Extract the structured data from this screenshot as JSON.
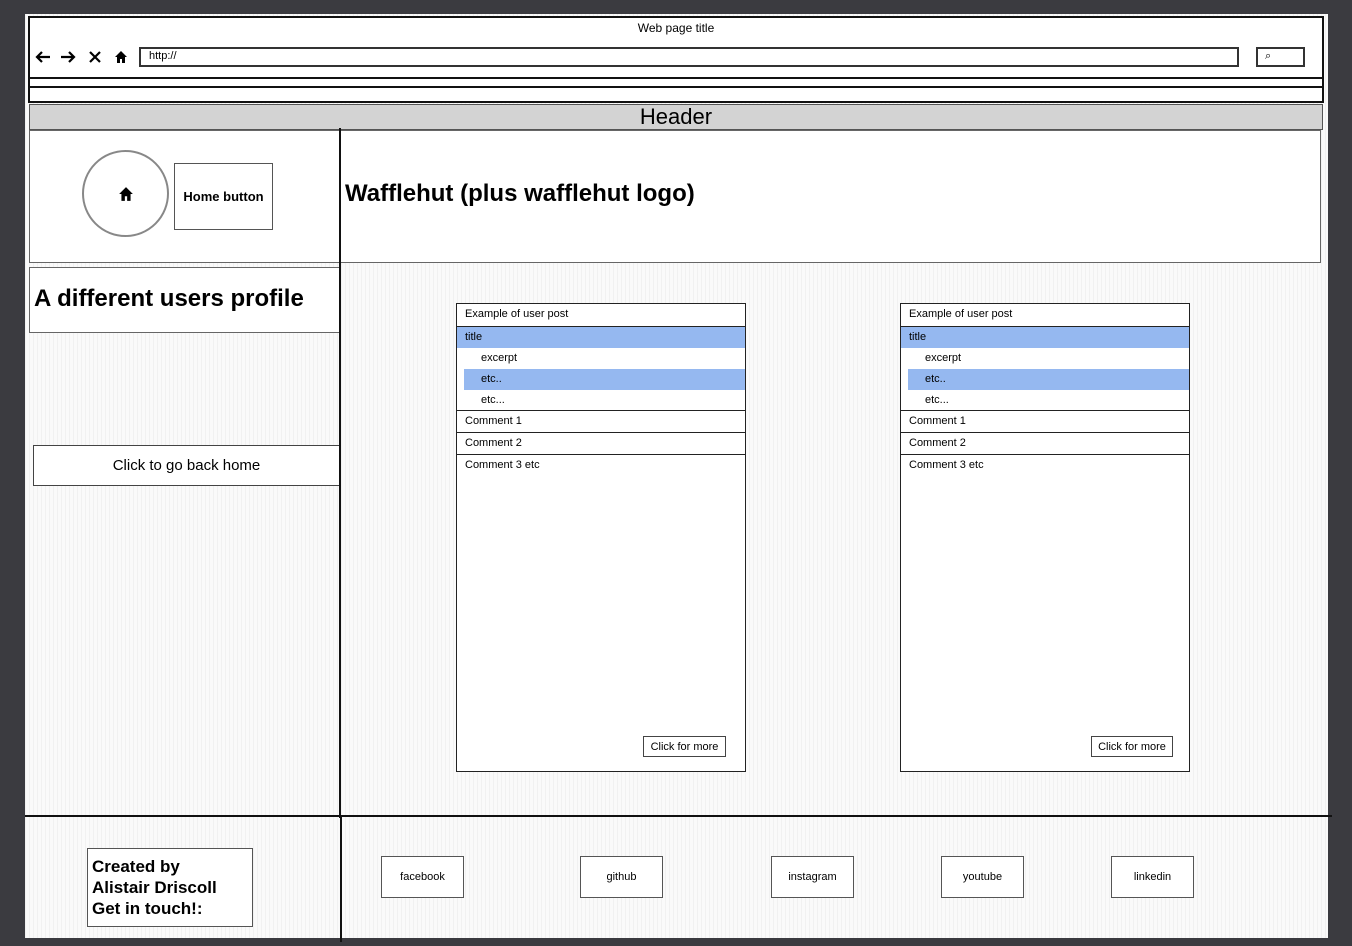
{
  "browser": {
    "window_title": "Web page title",
    "url": "http://",
    "search_glyph": "⌕",
    "nav_icons": [
      "arrow-left-icon",
      "arrow-right-icon",
      "close-icon",
      "home-icon"
    ]
  },
  "header": {
    "label": "Header"
  },
  "site": {
    "brand": "Wafflehut (plus wafflehut logo)",
    "home_button_label": "Home button"
  },
  "sidebar": {
    "profile_title": "A different users profile",
    "back_home_label": "Click to go back home"
  },
  "posts": [
    {
      "heading": "Example of user post",
      "title": "title",
      "excerpt": "excerpt",
      "item2": "etc..",
      "item3": "etc...",
      "comment1": "Comment 1",
      "comment2": "Comment 2",
      "comment3": "Comment 3 etc",
      "more_label": "Click for more"
    },
    {
      "heading": "Example of user post",
      "title": "title",
      "excerpt": "excerpt",
      "item2": "etc..",
      "item3": "etc...",
      "comment1": "Comment 1",
      "comment2": "Comment 2",
      "comment3": "Comment 3 etc",
      "more_label": "Click for more"
    }
  ],
  "footer": {
    "credit": [
      "Created by",
      "Alistair Driscoll",
      "Get in touch!:"
    ],
    "social": [
      "facebook",
      "github",
      "instagram",
      "youtube",
      "linkedin"
    ]
  },
  "colors": {
    "selection": "#95b8f0",
    "header_bar": "#d3d3d3",
    "backdrop": "#3b3b40"
  }
}
